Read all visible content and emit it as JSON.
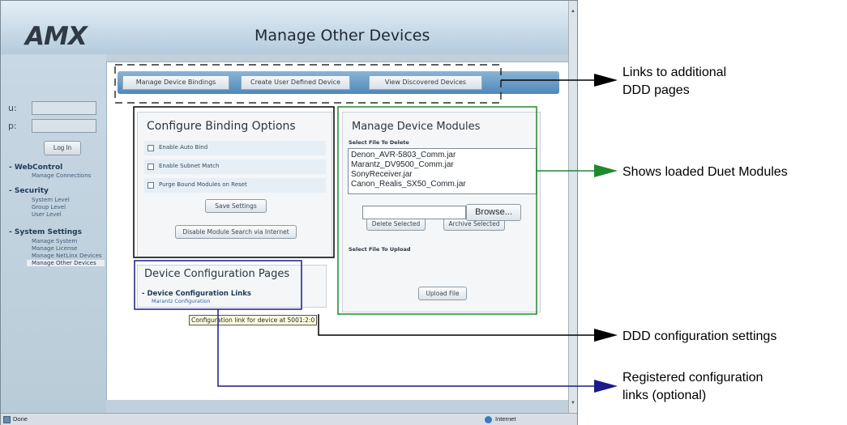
{
  "window": {
    "logo": "AMX",
    "page_title": "Manage Other Devices",
    "status_text": "Done",
    "zone_text": "Internet"
  },
  "login": {
    "user_label": "u:",
    "pass_label": "p:",
    "button": "Log In"
  },
  "sidebar": {
    "sections": [
      {
        "title": "- WebControl",
        "items": [
          "Manage Connections"
        ]
      },
      {
        "title": "- Security",
        "items": [
          "System Level",
          "Group Level",
          "User Level"
        ]
      },
      {
        "title": "- System Settings",
        "items": [
          "Manage System",
          "Manage License",
          "Manage NetLinx Devices",
          "Manage Other Devices"
        ]
      }
    ],
    "active_item": "Manage Other Devices"
  },
  "tabs": [
    "Manage Device Bindings",
    "Create User Defined Device",
    "View Discovered Devices"
  ],
  "binding_options": {
    "title": "Configure Binding Options",
    "options": [
      {
        "label": "Enable Auto Bind",
        "checked": false
      },
      {
        "label": "Enable Subnet Match",
        "checked": false
      },
      {
        "label": "Purge Bound Modules on Reset",
        "checked": false
      }
    ],
    "save_button": "Save Settings",
    "disable_button": "Disable Module Search via Internet"
  },
  "device_modules": {
    "title": "Manage Device Modules",
    "delete_label": "Select File To Delete",
    "files": [
      "Denon_AVR-5803_Comm.jar",
      "Marantz_DV9500_Comm.jar",
      "SonyReceiver.jar",
      "Canon_Realis_SX50_Comm.jar"
    ],
    "delete_button": "Delete Selected",
    "archive_button": "Archive Selected",
    "upload_label": "Select File To Upload",
    "browse_button": "Browse...",
    "upload_button": "Upload File"
  },
  "config_pages": {
    "title": "Device Configuration Pages",
    "section": "- Device Configuration Links",
    "link": "Marantz Configuration",
    "tooltip": "Configuration link for device at 5001:2:0"
  },
  "annotations": {
    "links": [
      "Links to additional",
      "DDD pages"
    ],
    "modules": "Shows loaded Duet Modules",
    "settings": "DDD configuration settings",
    "registered": [
      "Registered configuration",
      "links (optional)"
    ]
  },
  "colors": {
    "arrow_black": "#000000",
    "outline_green": "#1e8a2e",
    "outline_navy": "#1a1a8a"
  }
}
